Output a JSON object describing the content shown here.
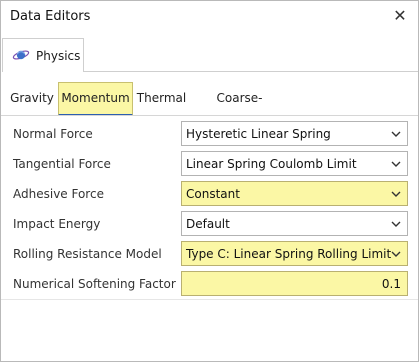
{
  "window": {
    "title": "Data Editors",
    "close_symbol": "✕"
  },
  "top_tabs": [
    {
      "label": "Physics",
      "icon": "planet-icon"
    }
  ],
  "sub_tabs": [
    {
      "label": "Gravity"
    },
    {
      "label": "Momentum"
    },
    {
      "label": "Thermal"
    },
    {
      "label": "Coarse-Graining"
    }
  ],
  "rows": [
    {
      "label": "Normal Force",
      "value": "Hysteretic Linear Spring"
    },
    {
      "label": "Tangential Force",
      "value": "Linear Spring Coulomb Limit"
    },
    {
      "label": "Adhesive Force",
      "value": "Constant"
    },
    {
      "label": "Impact Energy",
      "value": "Default"
    },
    {
      "label": "Rolling Resistance Model",
      "value": "Type C: Linear Spring Rolling Limit"
    },
    {
      "label": "Numerical Softening Factor",
      "value": "0.1"
    }
  ],
  "colors": {
    "highlight": "#fbf7a5",
    "active_tab_underline": "#2d5fb1"
  }
}
